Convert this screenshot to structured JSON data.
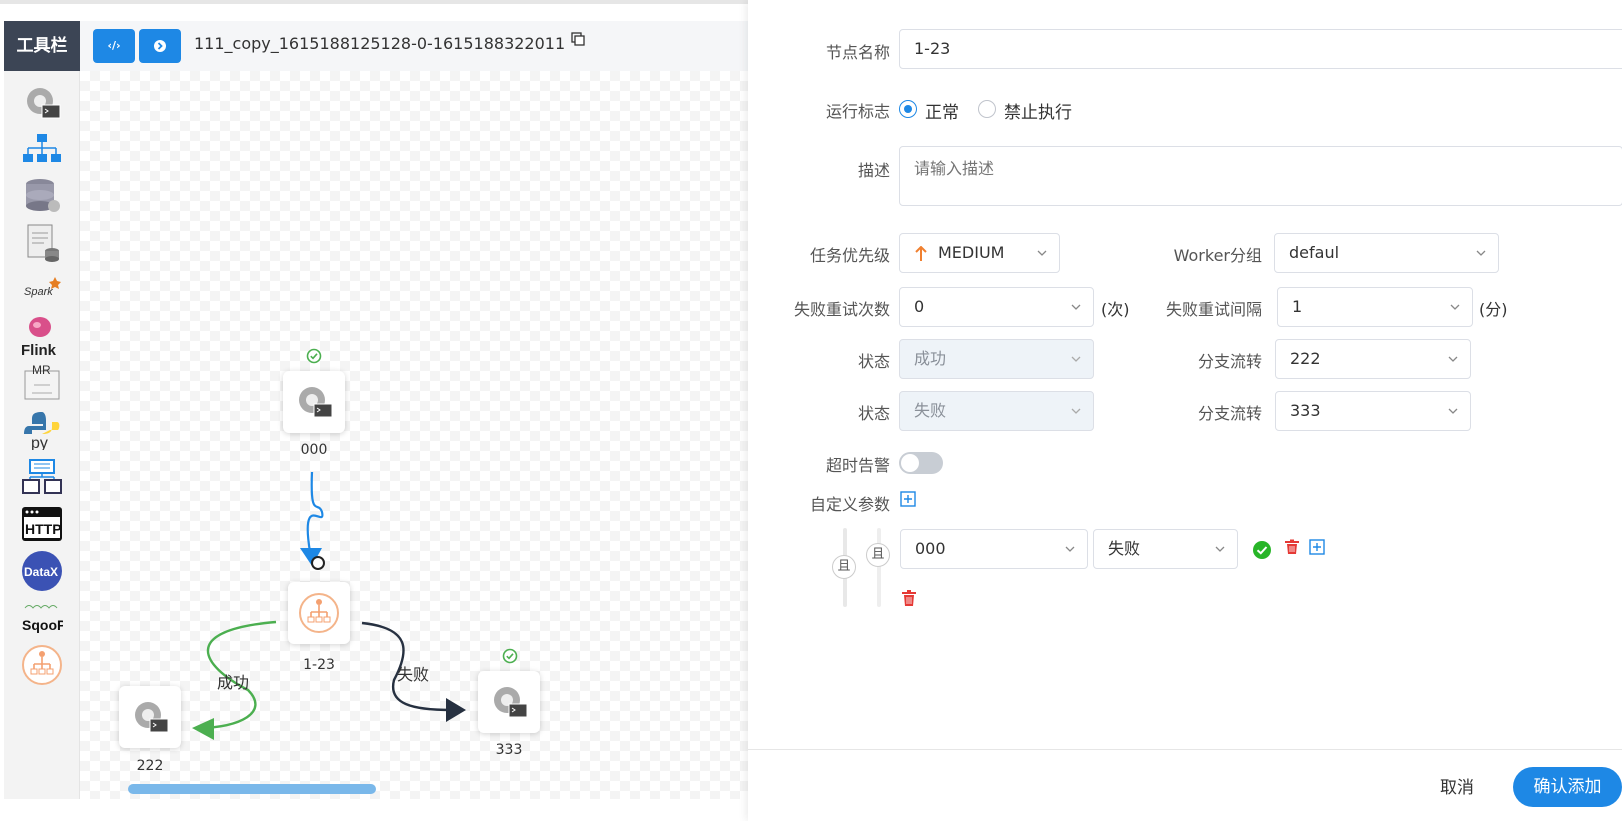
{
  "toolbar": {
    "title": "工具栏",
    "btn_code_glyph": "‹/›",
    "btn_run_glyph": "›"
  },
  "dag": {
    "name": "111_copy_1615188125128-0-1615188322011",
    "nodes": [
      {
        "id": "000",
        "label": "000",
        "type": "shell",
        "status": "success"
      },
      {
        "id": "1-23",
        "label": "1-23",
        "type": "conditions"
      },
      {
        "id": "222",
        "label": "222",
        "type": "shell"
      },
      {
        "id": "333",
        "label": "333",
        "type": "shell",
        "status": "success"
      }
    ],
    "edges": [
      {
        "from": "000",
        "to": "1-23",
        "label": "",
        "color": "#1e88e5"
      },
      {
        "from": "1-23",
        "to": "222",
        "label": "成功",
        "color": "#4caf50"
      },
      {
        "from": "1-23",
        "to": "333",
        "label": "失败",
        "color": "#263040"
      }
    ]
  },
  "tools": [
    {
      "name": "shell-icon"
    },
    {
      "name": "sub-process-icon"
    },
    {
      "name": "procedure-icon"
    },
    {
      "name": "sql-icon"
    },
    {
      "name": "spark-icon"
    },
    {
      "name": "flink-icon"
    },
    {
      "name": "mr-icon"
    },
    {
      "name": "python-icon"
    },
    {
      "name": "dependent-icon"
    },
    {
      "name": "http-icon"
    },
    {
      "name": "datax-icon"
    },
    {
      "name": "sqoop-icon"
    },
    {
      "name": "conditions-icon"
    }
  ],
  "tool_text": {
    "spark": "Spark",
    "flink": "Flink",
    "mr": "MR",
    "python": "py",
    "http": "HTTP",
    "datax": "DataX",
    "sqoop": "SqooP"
  },
  "form": {
    "node_name_label": "节点名称",
    "node_name_value": "1-23",
    "run_flag_label": "运行标志",
    "run_flag_options": [
      "正常",
      "禁止执行"
    ],
    "run_flag_selected": "正常",
    "description_label": "描述",
    "description_placeholder": "请输入描述",
    "priority_label": "任务优先级",
    "priority_value": "MEDIUM",
    "worker_group_label": "Worker分组",
    "worker_group_value": "defaul",
    "retry_times_label": "失败重试次数",
    "retry_times_value": "0",
    "retry_times_unit": "(次)",
    "retry_interval_label": "失败重试间隔",
    "retry_interval_value": "1",
    "retry_interval_unit": "(分)",
    "success_state_label": "状态",
    "success_state_value": "成功",
    "success_branch_label": "分支流转",
    "success_branch_value": "222",
    "failed_state_label": "状态",
    "failed_state_value": "失败",
    "failed_branch_label": "分支流转",
    "failed_branch_value": "333",
    "timeout_label": "超时告警",
    "timeout_enabled": false,
    "custom_params_label": "自定义参数",
    "condition": {
      "outer_relation": "且",
      "inner_relation": "且",
      "dep_task": "000",
      "dep_status": "失败"
    }
  },
  "footer": {
    "cancel_label": "取消",
    "confirm_label": "确认添加"
  },
  "colors": {
    "primary": "#1e88e5",
    "success": "#4caf50",
    "danger": "#e53935",
    "dark": "#263040",
    "toolbar_bg": "#3c4555"
  }
}
